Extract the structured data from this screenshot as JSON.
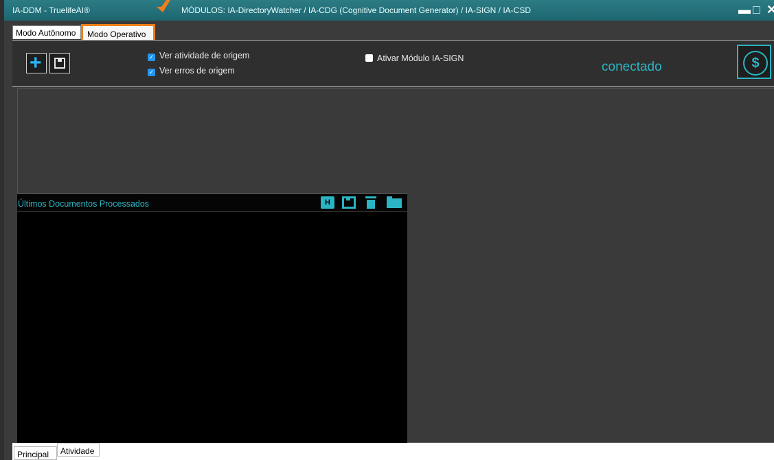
{
  "titlebar": {
    "app_title": "IA-DDM  -  TruelifeAI®",
    "modules": "MÓDULOS:  IA-DirectoryWatcher / IA-CDG (Cognitive Document Generator) / IA-SIGN / IA-CSD",
    "minimize": "▬",
    "maximize": "□",
    "close": "✕"
  },
  "tabs": [
    {
      "label": "Modo Autônomo"
    },
    {
      "label": "Modo Operativo",
      "highlighted": true
    }
  ],
  "toolbar": {
    "checkboxes": {
      "ver_atividade": {
        "label": "Ver atividade de origem",
        "checked": true
      },
      "ver_erros": {
        "label": "Ver erros de origem",
        "checked": true
      },
      "ativar_sign": {
        "label": "Ativar Módulo IA-SIGN",
        "checked": false
      }
    },
    "status": "conectado",
    "dollar_symbol": "$"
  },
  "panel": {
    "title": "Últimos Documentos Processados"
  },
  "bottom_tabs": [
    {
      "label": "Principal"
    },
    {
      "label": "Atividade"
    }
  ],
  "colors": {
    "accent": "#2bb5c4",
    "highlight": "#ef7f1a",
    "background": "#3b3b3b"
  }
}
